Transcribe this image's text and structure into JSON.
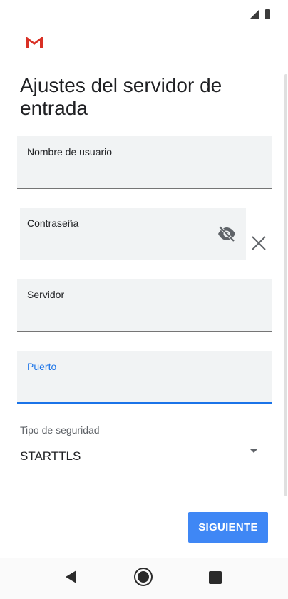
{
  "header": {
    "title": "Ajustes del servidor de entrada"
  },
  "fields": {
    "username": {
      "label": "Nombre de usuario",
      "value": ""
    },
    "password": {
      "label": "Contraseña",
      "value": ""
    },
    "server": {
      "label": "Servidor",
      "value": ""
    },
    "port": {
      "label": "Puerto",
      "value": ""
    }
  },
  "security": {
    "label": "Tipo de seguridad",
    "selected": "STARTTLS"
  },
  "actions": {
    "next_label": "SIGUIENTE"
  },
  "icons": {
    "app_logo": "gmail-logo",
    "password_toggle": "eye-off-icon",
    "clear": "close-icon",
    "nav": [
      "back-icon",
      "home-icon",
      "recents-icon"
    ]
  },
  "colors": {
    "accent": "#1a73e8",
    "button": "#3f87f5",
    "gmail_red": "#d93025"
  }
}
